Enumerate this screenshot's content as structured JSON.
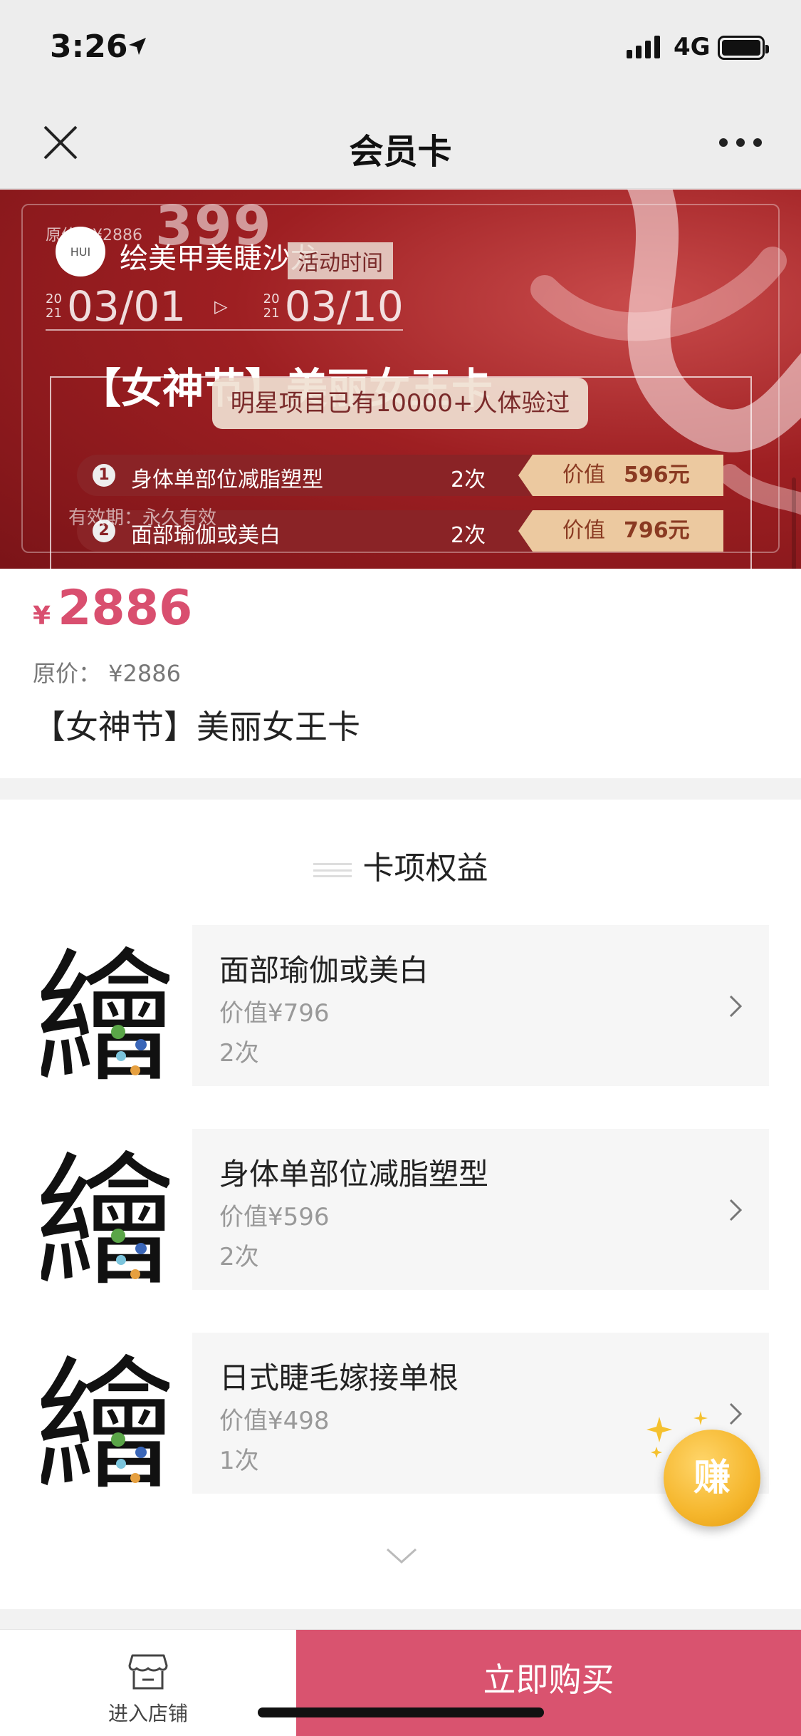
{
  "status_bar": {
    "time": "3:26",
    "network": "4G",
    "signal_bars": 4,
    "battery_level": 0.85
  },
  "nav": {
    "title": "会员卡",
    "close_icon": "close-icon",
    "more_icon": "more-icon"
  },
  "banner": {
    "original_price_text": "原价：¥2886",
    "event_price": "399",
    "shop_name": "绘美甲美睫沙龙",
    "shop_logo_text": "HUI",
    "activity_label": "活动时间",
    "start": {
      "year_top": "20",
      "year_bottom": "21",
      "date": "03/01"
    },
    "end": {
      "year_top": "20",
      "year_bottom": "21",
      "date": "03/10"
    },
    "arrow": "▷",
    "card_title": "【女神节】美丽女王卡",
    "star_text": "明星项目已有10000+人体验过",
    "items": [
      {
        "num": "1",
        "name": "身体单部位减脂塑型",
        "times": "2次",
        "value_label": "价值",
        "value": "596元"
      },
      {
        "num": "2",
        "name": "面部瑜伽或美白",
        "times": "2次",
        "value_label": "价值",
        "value": "796元"
      }
    ],
    "validity": "有效期：永久有效"
  },
  "price_card": {
    "currency": "¥",
    "price": "2886",
    "original_price": "原价：  ¥2886",
    "title": "【女神节】美丽女王卡"
  },
  "benefits": {
    "heading": "卡项权益",
    "logo_char": "繪",
    "items": [
      {
        "name": "面部瑜伽或美白",
        "value": "价值¥796",
        "count": "2次"
      },
      {
        "name": "身体单部位减脂塑型",
        "value": "价值¥596",
        "count": "2次"
      },
      {
        "name": "日式睫毛嫁接单根",
        "value": "价值¥498",
        "count": "1次"
      }
    ]
  },
  "earn_button": {
    "label": "赚"
  },
  "bottom_bar": {
    "store_label": "进入店铺",
    "buy_label": "立即购买"
  },
  "colors": {
    "accent": "#d9536f",
    "banner_red": "#9e1f22",
    "earn_gold": "#f5b62c"
  }
}
